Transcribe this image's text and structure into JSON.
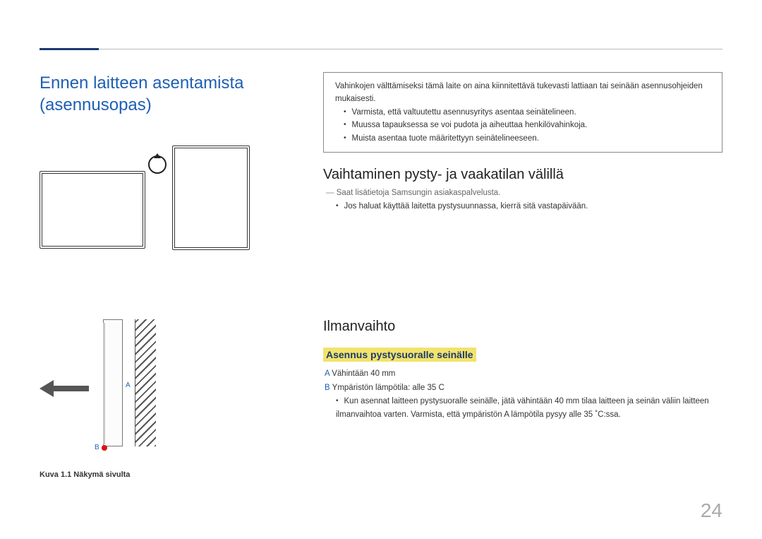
{
  "page": {
    "number": "24"
  },
  "left": {
    "title": "Ennen laitteen asentamista (asennusopas)",
    "gap_label": "A",
    "b_label": "B",
    "caption": "Kuva 1.1 Näkymä sivulta"
  },
  "warning": {
    "intro": "Vahinkojen välttämiseksi tämä laite on aina kiinnitettävä tukevasti lattiaan tai seinään asennusohjeiden mukaisesti.",
    "items": [
      "Varmista, että valtuutettu asennusyritys asentaa seinätelineen.",
      "Muussa tapauksessa se voi pudota ja aiheuttaa henkilövahinkoja.",
      "Muista asentaa tuote määritettyyn seinätelineeseen."
    ]
  },
  "switching": {
    "heading": "Vaihtaminen pysty- ja vaakatilan välillä",
    "note": "Saat lisätietoja Samsungin asiakaspalvelusta.",
    "items": [
      "Jos haluat käyttää laitetta pystysuunnassa, kierrä sitä vastapäivään."
    ]
  },
  "ventilation": {
    "heading": "Ilmanvaihto",
    "subheading": "Asennus pystysuoralle seinälle",
    "spec_a_key": "A",
    "spec_a_text": " Vähintään 40 mm",
    "spec_b_key": "B",
    "spec_b_text": " Ympäristön lämpötila: alle 35 C",
    "items": [
      "Kun asennat laitteen pystysuoralle seinälle, jätä vähintään 40 mm tilaa laitteen ja seinän väliin laitteen ilmanvaihtoa varten. Varmista, että ympäristön A lämpötila pysyy alle 35 ˚C:ssa."
    ]
  }
}
